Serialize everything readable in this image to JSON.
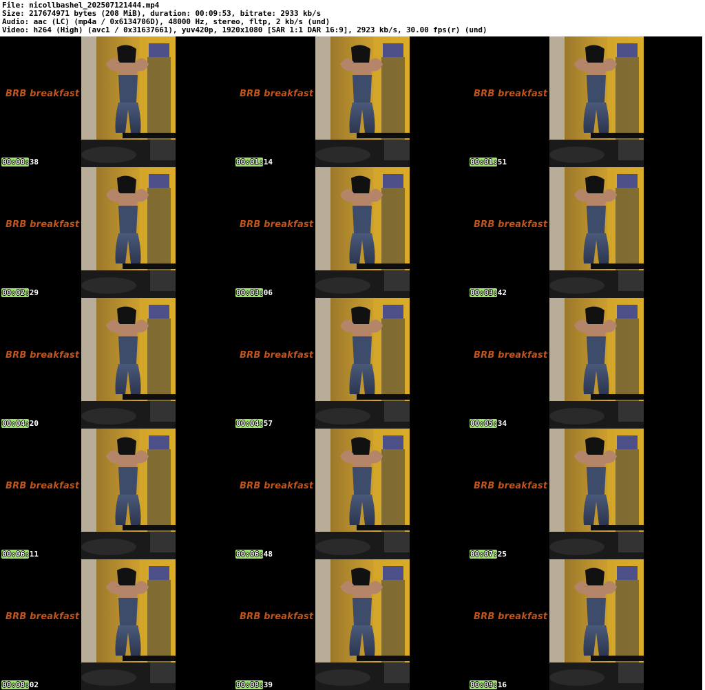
{
  "header": {
    "file_line": "File: nicollbashel_202507121444.mp4",
    "size_line": "Size: 217674971 bytes (208 MiB), duration: 00:09:53, bitrate: 2933 kb/s",
    "audio_line": "Audio: aac (LC) (mp4a / 0x6134706D), 48000 Hz, stereo, fltp, 2 kb/s (und)",
    "video_line": "Video: h264 (High) (avc1 / 0x31637661), yuv420p, 1920x1080 [SAR 1:1 DAR 16:9], 2923 kb/s, 30.00 fps(r) (und)"
  },
  "overlay_text": "BRB  breakfast",
  "colors": {
    "overlay_text": "#c0541a",
    "timestamp_bg": "#9be36a",
    "frame_bg": "#000000"
  },
  "thumbnails": [
    {
      "time": "00:00:38"
    },
    {
      "time": "00:01:14"
    },
    {
      "time": "00:01:51"
    },
    {
      "time": "00:02:29"
    },
    {
      "time": "00:03:06"
    },
    {
      "time": "00:03:42"
    },
    {
      "time": "00:04:20"
    },
    {
      "time": "00:04:57"
    },
    {
      "time": "00:05:34"
    },
    {
      "time": "00:06:11"
    },
    {
      "time": "00:06:48"
    },
    {
      "time": "00:07:25"
    },
    {
      "time": "00:08:02"
    },
    {
      "time": "00:08:39"
    },
    {
      "time": "00:09:16"
    }
  ]
}
